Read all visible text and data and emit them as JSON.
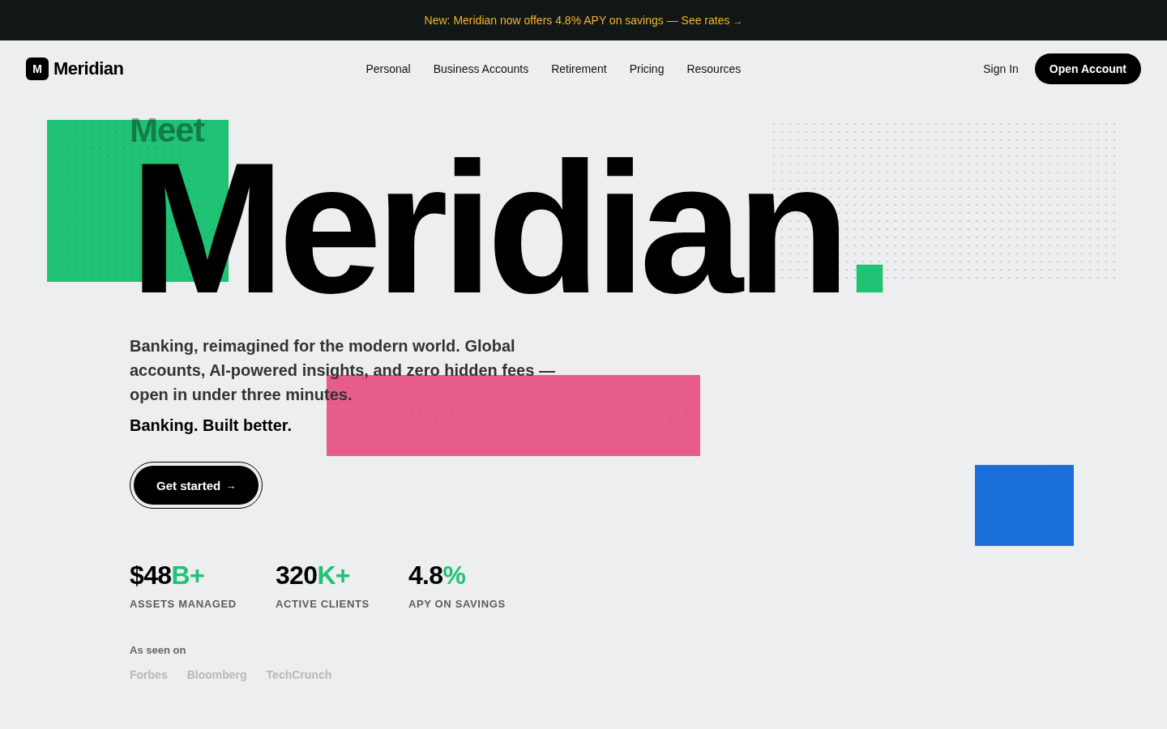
{
  "announcement": {
    "text": "New: Meridian now offers 4.8% APY on savings — See rates",
    "arrow": "→"
  },
  "header": {
    "logo": {
      "mark": "M",
      "name": "Meridian"
    },
    "nav": [
      "Personal",
      "Business Accounts",
      "Retirement",
      "Pricing",
      "Resources"
    ],
    "sign_in": "Sign In",
    "cta": "Open Account"
  },
  "hero": {
    "eyebrow": "Meet",
    "title": "Meridian",
    "title_accent": ".",
    "description": "Banking, reimagined for the modern world. Global accounts, AI-powered insights, and zero hidden fees — open in under three minutes.",
    "tagline": "Banking. Built better.",
    "button": {
      "label": "Get started",
      "arrow": "→"
    },
    "stats": [
      {
        "value": "$48",
        "suffix": "B+",
        "label": "ASSETS MANAGED"
      },
      {
        "value": "320",
        "suffix": "K+",
        "label": "ACTIVE CLIENTS"
      },
      {
        "value": "4.8",
        "suffix": "%",
        "label": "APY ON SAVINGS"
      }
    ],
    "press": {
      "heading": "As seen on",
      "outlets": [
        "Forbes",
        "Bloomberg",
        "TechCrunch"
      ]
    }
  }
}
